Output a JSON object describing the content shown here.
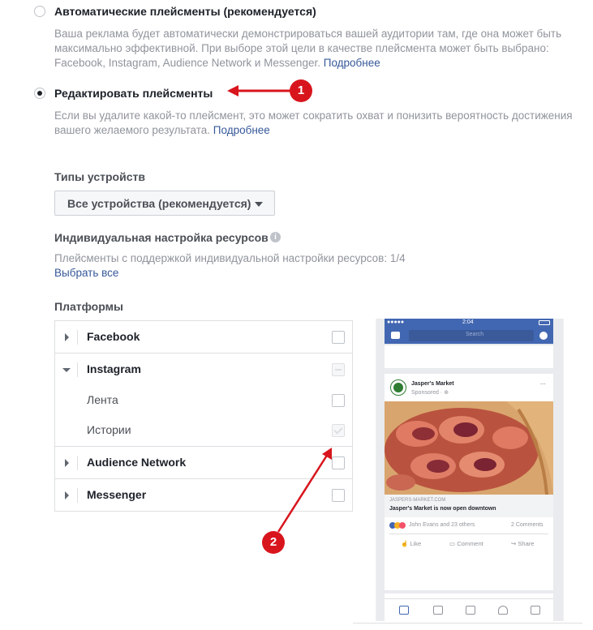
{
  "placement": {
    "auto": {
      "title": "Автоматические плейсменты (рекомендуется)",
      "desc_line1": "Ваша реклама будет автоматически демонстрироваться вашей аудитории там, где она может быть",
      "desc_line2": "максимально эффективной. При выборе этой цели в качестве плейсмента может быть выбрано:",
      "desc_line3": "Facebook, Instagram, Audience Network и Messenger.",
      "link": "Подробнее",
      "selected": false
    },
    "edit": {
      "title": "Редактировать плейсменты",
      "desc_line1": "Если вы удалите какой-то плейсмент, это может сократить охват и понизить вероятность достижения",
      "desc_line2": "вашего желаемого результата.",
      "link": "Подробнее",
      "selected": true
    }
  },
  "device_types": {
    "label": "Типы устройств",
    "selected": "Все устройства (рекомендуется)"
  },
  "asset_customization": {
    "label": "Индивидуальная настройка ресурсов",
    "info_icon": "i",
    "desc": "Плейсменты с поддержкой индивидуальной настройки ресурсов: 1/4",
    "select_all": "Выбрать все"
  },
  "platforms": {
    "label": "Платформы",
    "rows": [
      {
        "label": "Facebook",
        "kind": "platform",
        "expanded": false,
        "checked": false
      },
      {
        "label": "Instagram",
        "kind": "platform",
        "expanded": true,
        "checked": "partial"
      },
      {
        "label": "Лента",
        "kind": "sub",
        "checked": false
      },
      {
        "label": "Истории",
        "kind": "sub",
        "checked": true
      },
      {
        "label": "Audience Network",
        "kind": "platform",
        "expanded": false,
        "checked": false
      },
      {
        "label": "Messenger",
        "kind": "platform",
        "expanded": false,
        "checked": false
      }
    ]
  },
  "preview": {
    "time": "2:04",
    "search_placeholder": "Search",
    "page_name": "Jasper's Market",
    "sponsored": "Sponsored · ⊕",
    "url": "JASPERS-MARKET.COM",
    "headline": "Jasper's Market is now open downtown",
    "reactions": "John Evans and 23 others",
    "comments": "2 Comments",
    "like": "Like",
    "comment": "Comment",
    "share": "Share"
  },
  "annotations": {
    "badge1": "1",
    "badge2": "2"
  },
  "colors": {
    "link": "#365899",
    "facebook_blue": "#4267b2",
    "annotation_red": "#d8151d"
  }
}
